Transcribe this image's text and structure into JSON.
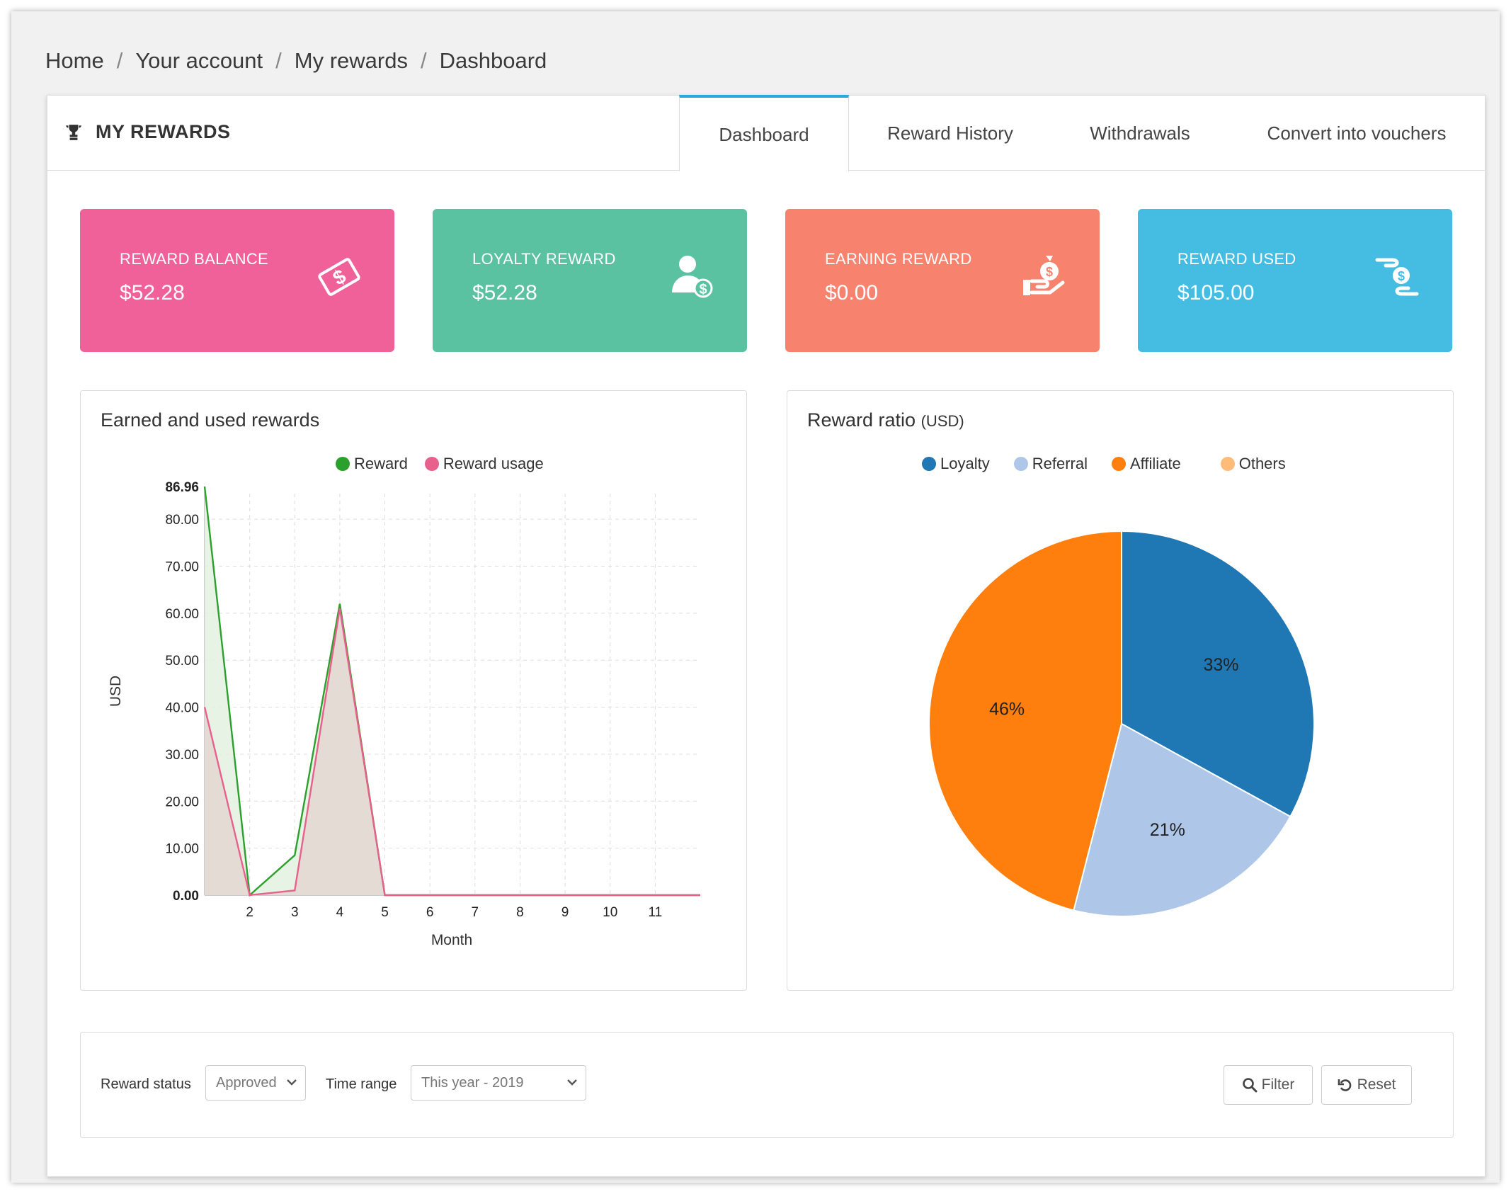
{
  "breadcrumb": {
    "items": [
      "Home",
      "Your account",
      "My rewards",
      "Dashboard"
    ],
    "separator": "/"
  },
  "panel": {
    "title": "MY REWARDS",
    "title_icon": "trophy-icon",
    "tabs": [
      {
        "label": "Dashboard",
        "active": true
      },
      {
        "label": "Reward History",
        "active": false
      },
      {
        "label": "Withdrawals",
        "active": false
      },
      {
        "label": "Convert into vouchers",
        "active": false
      }
    ],
    "accent_color": "#2aa8d8"
  },
  "cards": [
    {
      "label": "REWARD BALANCE",
      "value": "$52.28",
      "color": "#f0619a",
      "icon": "dollar-diamond-icon"
    },
    {
      "label": "LOYALTY REWARD",
      "value": "$52.28",
      "color": "#5ac2a0",
      "icon": "user-dollar-icon"
    },
    {
      "label": "EARNING REWARD",
      "value": "$0.00",
      "color": "#f7836f",
      "icon": "money-bag-hand-icon"
    },
    {
      "label": "REWARD USED",
      "value": "$105.00",
      "color": "#45bde3",
      "icon": "coin-hand-icon"
    }
  ],
  "line_box": {
    "title": "Earned and used rewards"
  },
  "pie_box": {
    "title": "Reward ratio",
    "title_unit": "(USD)"
  },
  "filter": {
    "status_label": "Reward status",
    "status_value": "Approved",
    "range_label": "Time range",
    "range_value": "This year - 2019",
    "filter_button": "Filter",
    "reset_button": "Reset"
  },
  "chart_data": [
    {
      "type": "area",
      "title": "Earned and used rewards",
      "xlabel": "Month",
      "ylabel": "USD",
      "x": [
        1,
        2,
        3,
        4,
        5,
        6,
        7,
        8,
        9,
        10,
        11,
        12
      ],
      "xticks": [
        "2",
        "3",
        "4",
        "5",
        "6",
        "7",
        "8",
        "9",
        "10",
        "11"
      ],
      "yticks": [
        "0.00",
        "10.00",
        "20.00",
        "30.00",
        "40.00",
        "50.00",
        "60.00",
        "70.00",
        "80.00",
        "86.96"
      ],
      "ylim": [
        0,
        86.96
      ],
      "grid": true,
      "legend_position": "top",
      "series": [
        {
          "name": "Reward",
          "color": "#2ca02c",
          "fill": "#e3f1df",
          "values": [
            86.96,
            0,
            8.5,
            62,
            0,
            0,
            0,
            0,
            0,
            0,
            0,
            0
          ]
        },
        {
          "name": "Reward usage",
          "color": "#e8618c",
          "fill": "#e3d8d2",
          "values": [
            40,
            0,
            1,
            61,
            0,
            0,
            0,
            0,
            0,
            0,
            0,
            0
          ]
        }
      ]
    },
    {
      "type": "pie",
      "title": "Reward ratio (USD)",
      "legend_position": "top",
      "slices": [
        {
          "name": "Loyalty",
          "value": 33,
          "label": "33%",
          "color": "#1f77b4"
        },
        {
          "name": "Referral",
          "value": 21,
          "label": "21%",
          "color": "#aec7e8"
        },
        {
          "name": "Affiliate",
          "value": 46,
          "label": "46%",
          "color": "#ff7f0e"
        },
        {
          "name": "Others",
          "value": 0,
          "label": "",
          "color": "#ffbb78"
        }
      ]
    }
  ]
}
